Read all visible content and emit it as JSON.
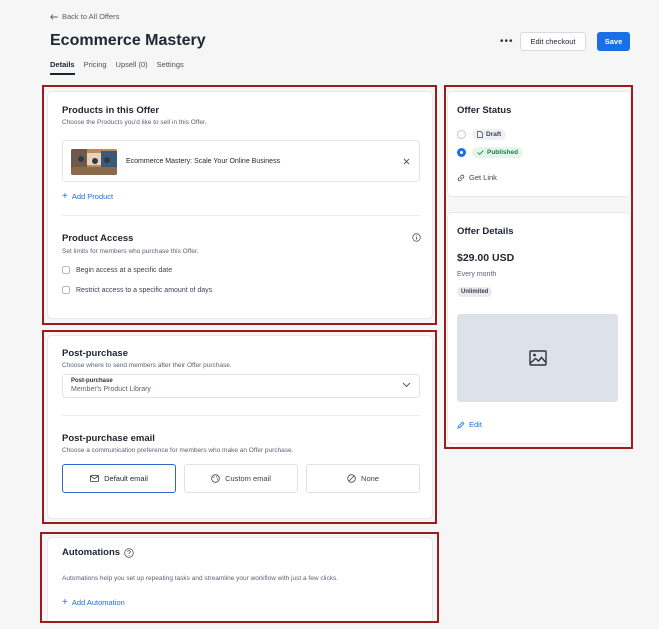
{
  "header": {
    "back_label": "Back to All Offers",
    "title": "Ecommerce Mastery",
    "more_label": "•••",
    "checkout_label": "Edit checkout",
    "save_label": "Save",
    "tabs": [
      {
        "label": "Details",
        "active": true
      },
      {
        "label": "Pricing",
        "active": false
      },
      {
        "label": "Upsell (0)",
        "active": false
      },
      {
        "label": "Settings",
        "active": false
      }
    ]
  },
  "products": {
    "title": "Products in this Offer",
    "subtitle": "Choose the Products you'd like to sell in this Offer.",
    "item_name": "Ecommerce Mastery: Scale Your Online Business",
    "add_label": "Add Product"
  },
  "access": {
    "title": "Product Access",
    "subtitle": "Set limits for members who purchase this Offer.",
    "options": [
      "Begin access at a specific date",
      "Restrict access to a specific amount of days"
    ]
  },
  "post_purchase": {
    "title": "Post-purchase",
    "subtitle": "Choose where to send members after their Offer purchase.",
    "select_label": "Post-purchase",
    "select_value": "Member's Product Library"
  },
  "email": {
    "title": "Post-purchase email",
    "subtitle": "Choose a communication preference for members who make an Offer purchase.",
    "options": [
      "Default email",
      "Custom email",
      "None"
    ],
    "selected": "Default email"
  },
  "automations": {
    "title": "Automations",
    "subtitle": "Automations help you set up repeating tasks and streamline your workflow with just a few clicks.",
    "add_label": "Add Automation"
  },
  "status": {
    "title": "Offer Status",
    "draft_label": "Draft",
    "published_label": "Published",
    "selected": "Published",
    "link_label": "Get Link"
  },
  "details": {
    "title": "Offer Details",
    "price": "$29.00 USD",
    "interval": "Every month",
    "badge": "Unlimited",
    "edit_label": "Edit"
  },
  "colors": {
    "accent": "#1a6fe6",
    "annotation_border": "#9b1c1c",
    "published_bg": "#e4f5ec"
  }
}
